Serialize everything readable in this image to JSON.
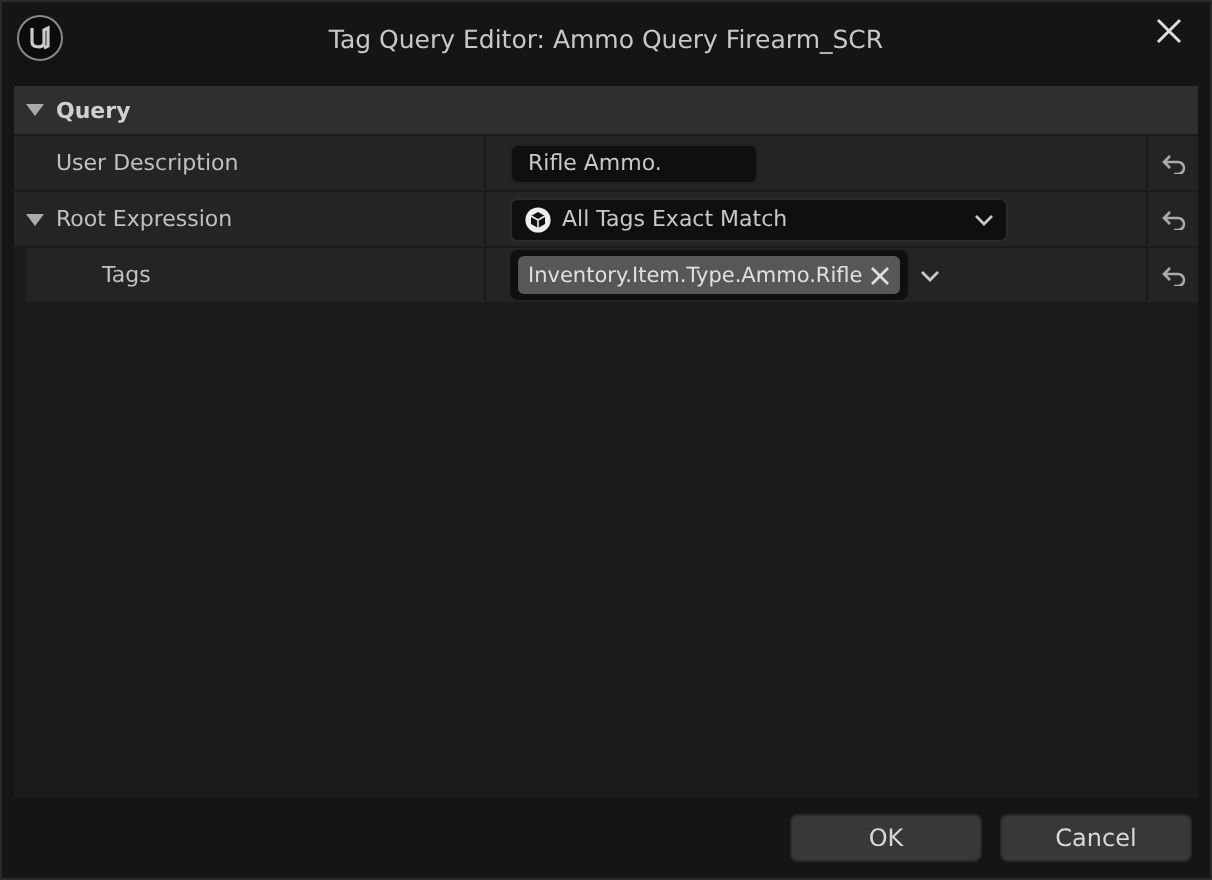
{
  "window": {
    "title": "Tag Query Editor: Ammo Query Firearm_SCR"
  },
  "category": {
    "label": "Query",
    "expanded": true
  },
  "rows": [
    {
      "label": "User Description",
      "kind": "text",
      "value": "Rifle Ammo."
    },
    {
      "label": "Root Expression",
      "kind": "combo",
      "value": "All Tags Exact Match",
      "expanded": true,
      "children": [
        {
          "label": "Tags",
          "kind": "tags",
          "tags": [
            "Inventory.Item.Type.Ammo.Rifle"
          ]
        }
      ]
    }
  ],
  "buttons": [
    "OK",
    "Cancel"
  ]
}
